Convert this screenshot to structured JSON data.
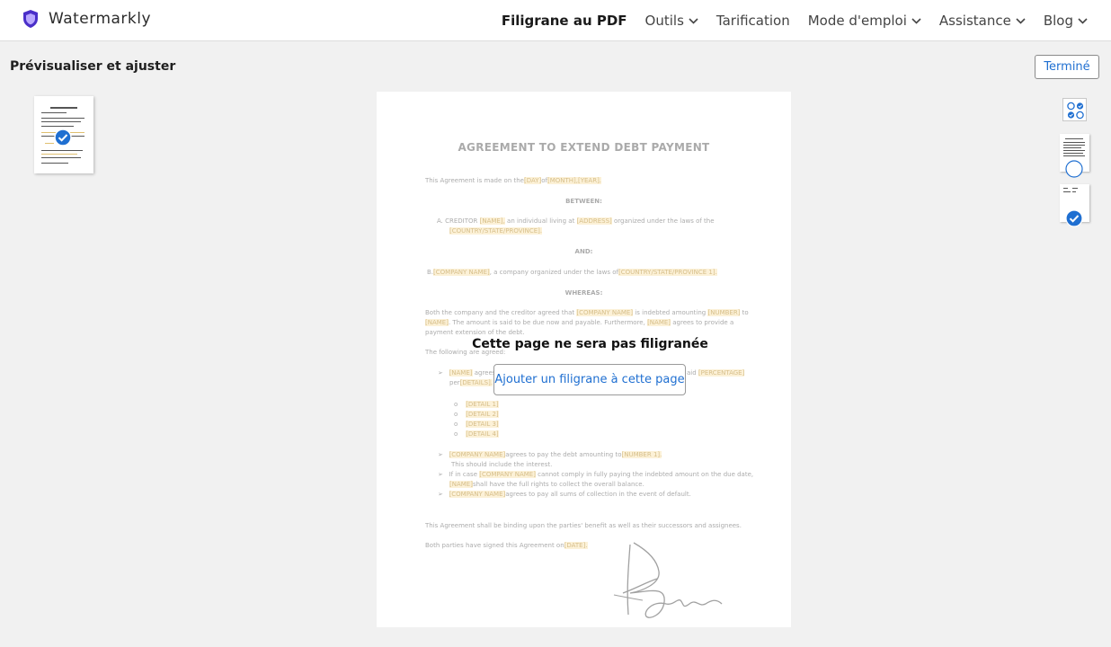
{
  "brand": {
    "name": "Watermarkly",
    "accent": "#4a2fc9"
  },
  "nav": {
    "items": [
      {
        "label": "Filigrane au PDF",
        "active": true,
        "dropdown": false
      },
      {
        "label": "Outils",
        "active": false,
        "dropdown": true
      },
      {
        "label": "Tarification",
        "active": false,
        "dropdown": false
      },
      {
        "label": "Mode d'emploi",
        "active": false,
        "dropdown": true
      },
      {
        "label": "Assistance",
        "active": false,
        "dropdown": true
      },
      {
        "label": "Blog",
        "active": false,
        "dropdown": true
      }
    ]
  },
  "toolbar": {
    "title": "Prévisualiser et ajuster",
    "done_label": "Terminé"
  },
  "page": {
    "message": "Cette page ne sera pas filigranée",
    "add_button": "Ajouter un filigrane à cette page"
  },
  "document": {
    "title": "AGREEMENT TO EXTEND DEBT PAYMENT",
    "intro": "This Agreement is made on the",
    "day": "[DAY]",
    "of": "of",
    "month": "[MONTH],",
    "year": "[YEAR].",
    "between": "BETWEEN:",
    "creditor_a": "A.   CREDITOR",
    "creditor_name": "[NAME],",
    "creditor_rest": " an individual        living at",
    "address": "[ADDRESS]",
    "creditor_rest2": " organized under      the laws of     the",
    "country": "[COUNTRY/STATE/PROVINCE].",
    "and": "AND:",
    "company_b": "B.",
    "company_name": "[COMPANY NAME]",
    "company_rest": ", a company organized under the laws of",
    "company_country": "[COUNTRY/STATE/PROVINCE 1].",
    "whereas": "WHEREAS:",
    "w1a": "Both the company and the creditor agreed that",
    "w1_company": "[COMPANY NAME]",
    "w1b": " is indebted amounting",
    "w1_number": "[NUMBER]",
    "w1c": " to",
    "w2_name": "[NAME]",
    "w2a": ". The amount is said to be due now and payable. Furthermore,",
    "w2_name2": "[NAME]",
    "w2b": " agrees to provide a",
    "w3": "payment extension of the debt.",
    "following": "The following are agreed:",
    "f1_name": "[NAME]",
    "f1a": " agrees",
    "f1b": "aid",
    "f1_pct": "[PERCENTAGE]",
    "f2a": "per",
    "f2_details": "[DETAILS].",
    "details": [
      "[DETAIL 1]",
      "[DETAIL 2]",
      "[DETAIL 3]",
      "[DETAIL 4]"
    ],
    "g1_company": "[COMPANY NAME]",
    "g1a": "agrees to pay the debt amounting to",
    "g1_number": "[NUMBER 1].",
    "g2": "This should include the interest.",
    "g3a": "If in case",
    "g3_company": "[COMPANY NAME]",
    "g3b": " cannot comply in fully paying the indebted amount on the due date,",
    "g4_name": "[NAME]",
    "g4a": "shall have the full rights to collect the overall balance.",
    "g5_company": "[COMPANY NAME]",
    "g5a": "agrees to pay all sums of collection in the event of default.",
    "binding": "This Agreement shall be binding upon the parties' benefit as well as their successors and assignees.",
    "signed": "Both parties have signed this Agreement on",
    "date": "[DATE]."
  }
}
